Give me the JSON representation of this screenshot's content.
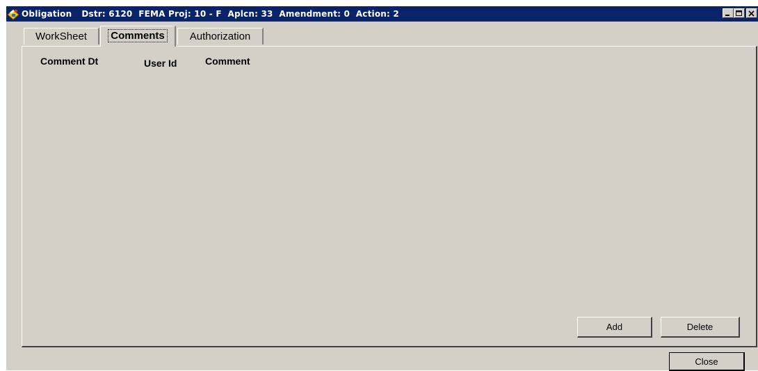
{
  "window": {
    "title_segments": [
      "Obligation",
      "Dstr: 6120  FEMA Proj: 10 - F  Aplcn: 33  Amendment: 0  Action: 2"
    ],
    "icon": "obligation-app-icon",
    "controls": [
      "minimize-icon",
      "maximize-icon",
      "close-icon"
    ]
  },
  "tabs": [
    {
      "label": "WorkSheet",
      "selected": false
    },
    {
      "label": "Comments",
      "selected": true
    },
    {
      "label": "Authorization",
      "selected": false
    }
  ],
  "comments_table": {
    "columns": [
      "Comment Dt",
      "User Id",
      "Comment"
    ],
    "rows": []
  },
  "buttons": {
    "add": "Add",
    "delete": "Delete",
    "close": "Close"
  },
  "colors": {
    "titlebar": "#0a246a",
    "face": "#d4d0c8"
  }
}
